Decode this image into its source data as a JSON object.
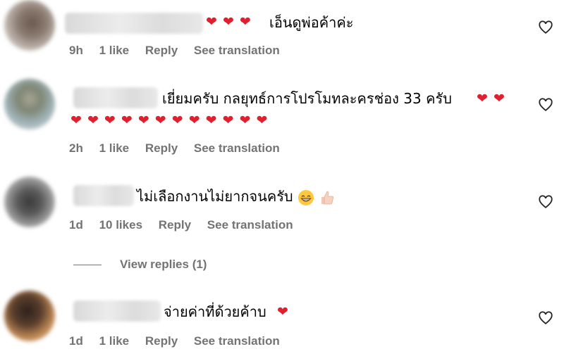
{
  "accent": {
    "heart": "#e0202e",
    "meta": "#737373"
  },
  "comments": [
    {
      "avatar": "avatar-blurred",
      "prefix_emoji": "❤ ❤ ❤",
      "text": "เอ็นดูพ่อค้าค่ะ",
      "time": "9h",
      "likes": "1 like",
      "reply": "Reply",
      "translate": "See translation"
    },
    {
      "avatar": "avatar-blurred",
      "text": "เยี่ยมครับ กลยุทธ์การโปรโมทละครช่อง 33 ครับ",
      "suffix_emoji": "❤ ❤",
      "emoji_line": "❤ ❤ ❤ ❤ ❤ ❤ ❤ ❤ ❤ ❤ ❤ ❤",
      "time": "2h",
      "likes": "1 like",
      "reply": "Reply",
      "translate": "See translation"
    },
    {
      "avatar": "avatar-blurred",
      "text": "ไม่เลือกงานไม่ยากจนครับ",
      "suffix_emoji": "grinning-face thumbs-up",
      "time": "1d",
      "likes": "10 likes",
      "reply": "Reply",
      "translate": "See translation",
      "view_replies": "View replies (1)"
    },
    {
      "avatar": "avatar-blurred",
      "text": "จ่ายค่าที่ด้วยค้าบ",
      "suffix_emoji": "❤",
      "time": "1d",
      "likes": "1 like",
      "reply": "Reply",
      "translate": "See translation"
    }
  ]
}
